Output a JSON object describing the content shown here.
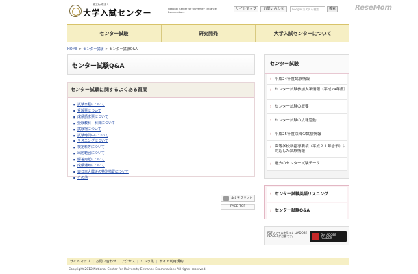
{
  "header": {
    "org_small": "独立行政法人",
    "org_name": "大学入試センター",
    "org_en": "National Center for University Entrance Examinations",
    "sitemap_label": "サイトマップ",
    "contact_label": "お問い合わせ",
    "search_placeholder": "Google カスタム検索",
    "search_button": "検索"
  },
  "watermark": "ReseMom",
  "nav": {
    "items": [
      "センター試験",
      "研究開発",
      "大学入試センターについて"
    ]
  },
  "breadcrumb": {
    "home": "HOME",
    "parent": "センター試験",
    "current": "センター試験Q&A"
  },
  "main": {
    "page_title": "センター試験Q&A",
    "faq_heading": "センター試験に関するよくある質問",
    "faq_items": [
      "試験日程について",
      "受験票について",
      "成績請求票について",
      "受験教科・科目について",
      "試験場について",
      "試験時間中について",
      "リスニングについて",
      "検定料等について",
      "出題範囲について",
      "解答用紙について",
      "成績通知について",
      "東日本大震災の特別措置について",
      "その他"
    ],
    "print_label": "本文をプリント",
    "top_label": "PAGE TOP"
  },
  "sidebar": {
    "heading": "センター試験",
    "items": [
      "平成24年度試験情報",
      "センター試験参加大学情報（平成24年度）",
      "センター試験の概要",
      "センター試験の広報活動",
      "平成25年度以降の試験情報",
      "高等学校新指導要領（平成２１年告示）に対応した試験情報",
      "過去のセンター試験データ"
    ],
    "box2_items": [
      "センター試験英語リスニング",
      "センター試験Q&A"
    ],
    "pdf_text": "PDFファイルを見るにはADOBE READERが必要です。",
    "pdf_badge": "Get ADOBE READER"
  },
  "footer": {
    "links": [
      "サイトマップ",
      "お問い合わせ",
      "アクセス",
      "リンク集",
      "サイト利用規約"
    ],
    "copyright": "Copyright 2012 National Center for University Entrance Examinations All rights reserved."
  }
}
